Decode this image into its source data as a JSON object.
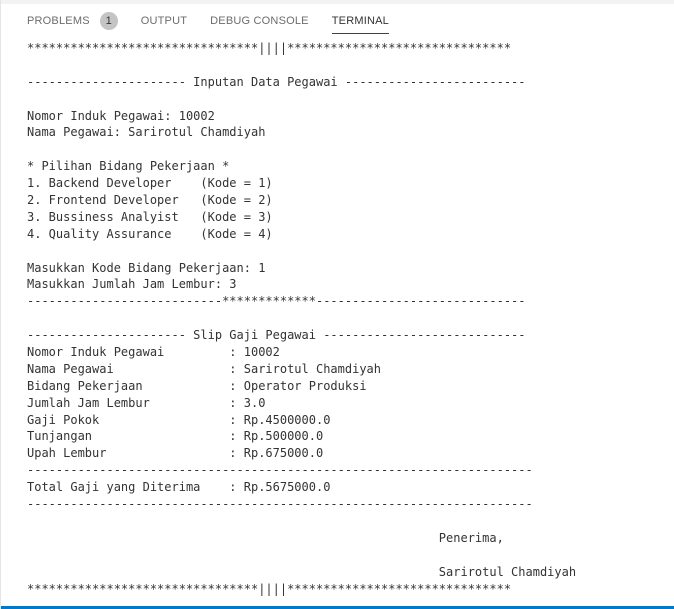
{
  "tabs": {
    "problems": "PROBLEMS",
    "problems_count": "1",
    "output": "OUTPUT",
    "debug_console": "DEBUG CONSOLE",
    "terminal": "TERMINAL"
  },
  "terminal": {
    "lines": [
      "********************************||||*******************************",
      "",
      "---------------------- Inputan Data Pegawai -------------------------",
      "",
      "Nomor Induk Pegawai: 10002",
      "Nama Pegawai: Sarirotul Chamdiyah",
      "",
      "* Pilihan Bidang Pekerjaan *",
      "1. Backend Developer    (Kode = 1)",
      "2. Frontend Developer   (Kode = 2)",
      "3. Bussiness Analyist   (Kode = 3)",
      "4. Quality Assurance    (Kode = 4)",
      "",
      "Masukkan Kode Bidang Pekerjaan: 1",
      "Masukkan Jumlah Jam Lembur: 3",
      "---------------------------*************-----------------------------",
      "",
      "---------------------- Slip Gaji Pegawai ----------------------------",
      "Nomor Induk Pegawai         : 10002",
      "Nama Pegawai                : Sarirotul Chamdiyah",
      "Bidang Pekerjaan            : Operator Produksi",
      "Jumlah Jam Lembur           : 3.0",
      "Gaji Pokok                  : Rp.4500000.0",
      "Tunjangan                   : Rp.500000.0",
      "Upah Lembur                 : Rp.675000.0",
      "----------------------------------------------------------------------",
      "Total Gaji yang Diterima    : Rp.5675000.0",
      "----------------------------------------------------------------------",
      "",
      "                                                         Penerima,",
      "",
      "                                                         Sarirotul Chamdiyah",
      "********************************||||*******************************"
    ]
  }
}
